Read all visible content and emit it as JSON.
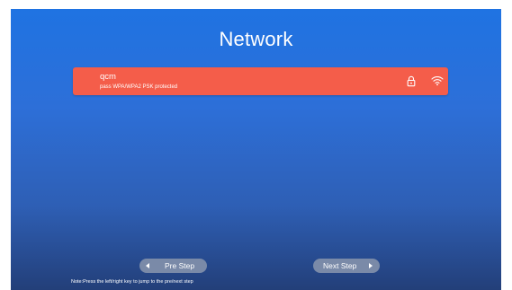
{
  "title": "Network",
  "networks": [
    {
      "ssid": "qcm",
      "security": "pass WPA/WPA2 PSK protected",
      "icons": [
        "lock-icon",
        "wifi-signal-icon"
      ],
      "selected": true
    }
  ],
  "buttons": {
    "pre_label": "Pre Step",
    "next_label": "Next Step"
  },
  "note": "Note:Press the left/right key to jump to the pre/next step",
  "colors": {
    "background": "#2d6fd8",
    "selected_row": "#f45d4a",
    "button": "#7a8aa8",
    "text": "#ffffff"
  }
}
